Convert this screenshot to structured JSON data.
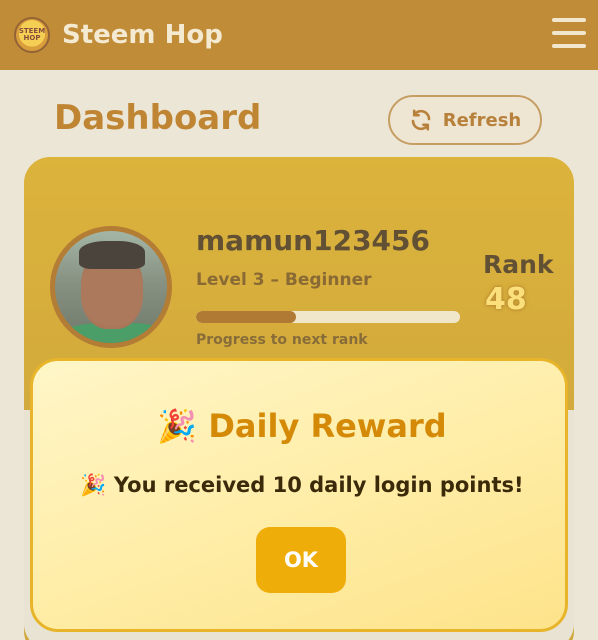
{
  "header": {
    "logo_text": "STEEM HOP",
    "brand": "Steem Hop",
    "menu_icon": "hamburger-menu-icon"
  },
  "dashboard": {
    "title": "Dashboard",
    "refresh_label": "Refresh",
    "refresh_icon": "refresh-icon"
  },
  "profile": {
    "username": "mamun123456",
    "level": "Level 3 – Beginner",
    "progress_fraction": 0.38,
    "progress_label": "Progress to next rank",
    "rank_label": "Rank",
    "rank_value": "48"
  },
  "modal": {
    "title": "🎉 Daily Reward",
    "message": "🎉 You received 10 daily login points!",
    "ok_label": "OK"
  },
  "colors": {
    "header_bg": "#b5730c",
    "accent": "#d48a06",
    "card_gold": "#d8a410",
    "button_gold": "#efad09"
  }
}
